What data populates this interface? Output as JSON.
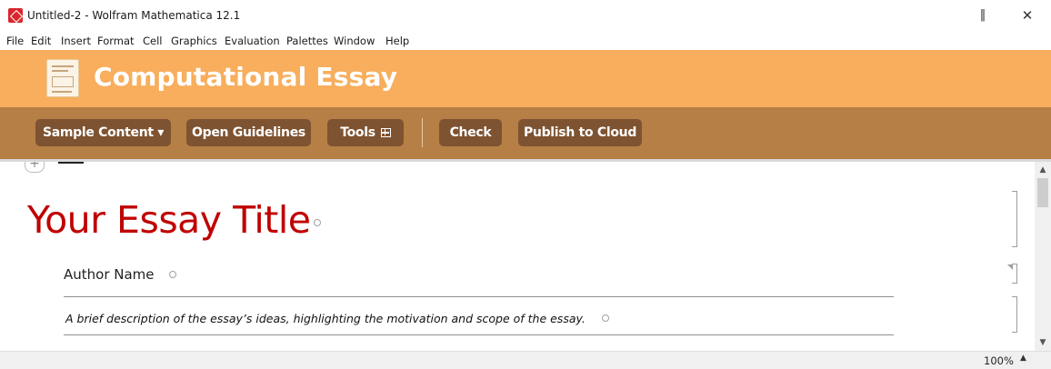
{
  "window": {
    "title": "Untitled-2 - Wolfram Mathematica 12.1",
    "restore_glyph": "‖",
    "close_glyph": "✕"
  },
  "menu": [
    "File",
    "Edit",
    "Insert",
    "Format",
    "Cell",
    "Graphics",
    "Evaluation",
    "Palettes",
    "Window",
    "Help"
  ],
  "header": {
    "title": "Computational Essay",
    "background": "#f8ae5c"
  },
  "toolbar": {
    "background": "#b67f45",
    "button_color": "#7e5331",
    "sample_content": "Sample Content ▾",
    "open_guidelines": "Open Guidelines",
    "tools": "Tools",
    "check": "Check",
    "publish": "Publish to Cloud"
  },
  "notebook": {
    "insert_glyph": "+",
    "essay_title": "Your Essay Title",
    "title_color": "#c00000",
    "author_name": "Author Name",
    "abstract": "A brief description of the essay’s ideas, highlighting the motivation and scope of the essay."
  },
  "scrollbar": {
    "up_glyph": "▲",
    "down_glyph": "▼"
  },
  "status": {
    "zoom": "100%",
    "zoom_glyph": "▲"
  }
}
